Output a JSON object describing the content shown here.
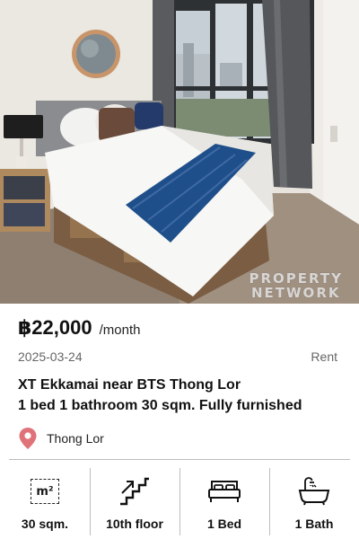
{
  "listing": {
    "watermark": [
      "PROPERTY",
      "NETWORK"
    ],
    "price": "฿22,000",
    "price_unit": "/month",
    "date": "2025-03-24",
    "type": "Rent",
    "title_line1": "XT Ekkamai near BTS Thong Lor",
    "title_line2": "1 bed 1 bathroom 30 sqm. Fully furnished",
    "location": "Thong Lor"
  },
  "features": [
    {
      "icon": "area-icon",
      "label": "30 sqm.",
      "icon_text": "m²"
    },
    {
      "icon": "stairs-icon",
      "label": "10th floor"
    },
    {
      "icon": "bed-icon",
      "label": "1 Bed"
    },
    {
      "icon": "bathtub-icon",
      "label": "1 Bath"
    }
  ],
  "colors": {
    "pin": "#e0737a",
    "divider": "#bdbdbd",
    "text": "#111111",
    "muted": "#666666"
  }
}
